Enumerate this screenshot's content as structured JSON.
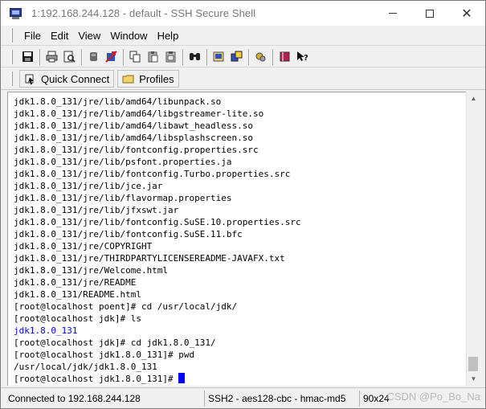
{
  "window": {
    "title": "1:192.168.244.128 - default - SSH Secure Shell"
  },
  "menu": {
    "file": "File",
    "edit": "Edit",
    "view": "View",
    "window": "Window",
    "help": "Help"
  },
  "toolbar": {
    "icons": [
      "save-icon",
      "print-icon",
      "print-preview-icon",
      "disconnect-icon",
      "connect-icon",
      "copy-icon",
      "paste-icon",
      "paste-alt-icon",
      "find-icon",
      "settings-icon",
      "file-transfer-icon",
      "options-icon",
      "book-icon",
      "help-context-icon"
    ]
  },
  "quickbar": {
    "quick_connect": "Quick Connect",
    "profiles": "Profiles"
  },
  "terminal": {
    "lines": [
      "jdk1.8.0_131/jre/lib/amd64/libunpack.so",
      "jdk1.8.0_131/jre/lib/amd64/libgstreamer-lite.so",
      "jdk1.8.0_131/jre/lib/amd64/libawt_headless.so",
      "jdk1.8.0_131/jre/lib/amd64/libsplashscreen.so",
      "jdk1.8.0_131/jre/lib/fontconfig.properties.src",
      "jdk1.8.0_131/jre/lib/psfont.properties.ja",
      "jdk1.8.0_131/jre/lib/fontconfig.Turbo.properties.src",
      "jdk1.8.0_131/jre/lib/jce.jar",
      "jdk1.8.0_131/jre/lib/flavormap.properties",
      "jdk1.8.0_131/jre/lib/jfxswt.jar",
      "jdk1.8.0_131/jre/lib/fontconfig.SuSE.10.properties.src",
      "jdk1.8.0_131/jre/lib/fontconfig.SuSE.11.bfc",
      "jdk1.8.0_131/jre/COPYRIGHT",
      "jdk1.8.0_131/jre/THIRDPARTYLICENSEREADME-JAVAFX.txt",
      "jdk1.8.0_131/jre/Welcome.html",
      "jdk1.8.0_131/jre/README",
      "jdk1.8.0_131/README.html",
      "[root@localhost poent]# cd /usr/local/jdk/",
      "[root@localhost jdk]# ls",
      "jdk1.8.0_131",
      "[root@localhost jdk]# cd jdk1.8.0_131/",
      "[root@localhost jdk1.8.0_131]# pwd",
      "/usr/local/jdk/jdk1.8.0_131",
      "[root@localhost jdk1.8.0_131]# "
    ],
    "dir_color": "#0000ff",
    "cursor_color": "#0000ff"
  },
  "status": {
    "connection": "Connected to 192.168.244.128",
    "crypto": "SSH2 - aes128-cbc - hmac-md5",
    "size": "90x24",
    "watermark": "CSDN @Po_Bo_Na"
  }
}
